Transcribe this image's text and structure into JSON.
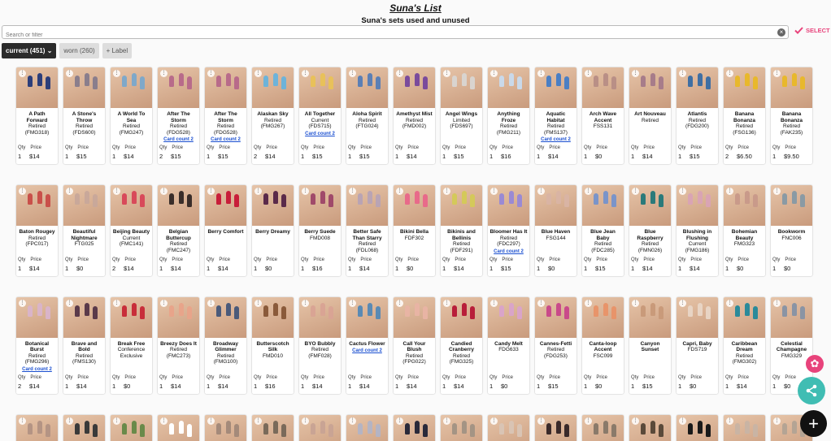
{
  "page": {
    "title": "Suna's List",
    "subtitle": "Suna's sets used and unused"
  },
  "search": {
    "placeholder": "Search or filter",
    "value": "",
    "clear_icon": "close-circle-icon"
  },
  "select": {
    "label": "SELECT",
    "icon": "check-icon",
    "color": "#e8437b"
  },
  "tabs": [
    {
      "label": "current (451)",
      "icon": "chevron-down-icon",
      "active": true
    },
    {
      "label": "worn (260)",
      "active": false
    },
    {
      "label": "+ Label",
      "active": false
    }
  ],
  "qty_label": "Qty",
  "price_label": "Price",
  "card_count_label": "Card count 2",
  "cards": [
    {
      "name": "A Path Forward",
      "status": "Retired",
      "code": "(FMG318)",
      "qty": "1",
      "price": "$14",
      "color": "#2c3e7a"
    },
    {
      "name": "A Stone's Throw",
      "status": "Retired",
      "code": "(FDS600)",
      "qty": "1",
      "price": "$15",
      "color": "#8a7e8c"
    },
    {
      "name": "A World To Sea",
      "status": "Retired",
      "code": "(FMG247)",
      "qty": "1",
      "price": "$14",
      "color": "#7fa8c9"
    },
    {
      "name": "After The Storm",
      "status": "Retired",
      "code": "(FDG528)",
      "qty": "2",
      "price": "$15",
      "color": "#b86b8a",
      "card_count": true
    },
    {
      "name": "After The Storm",
      "status": "Retired",
      "code": "(FDG528)",
      "qty": "1",
      "price": "$15",
      "color": "#b86b8a",
      "card_count": true
    },
    {
      "name": "Alaskan Sky",
      "status": "Retired",
      "code": "(FMG267)",
      "qty": "2",
      "price": "$14",
      "color": "#6db3d9"
    },
    {
      "name": "All Together",
      "status": "Current",
      "code": "(FDS715)",
      "qty": "1",
      "price": "$15",
      "color": "#e8c15a",
      "card_count": true
    },
    {
      "name": "Aloha Spirit",
      "status": "Retired",
      "code": "(FTG024)",
      "qty": "1",
      "price": "$15",
      "color": "#5b7fb5"
    },
    {
      "name": "Amethyst Mist",
      "status": "Retired",
      "code": "(FMD002)",
      "qty": "1",
      "price": "$14",
      "color": "#7a4b9c"
    },
    {
      "name": "Angel Wings",
      "status": "Limited",
      "code": "(FDS697)",
      "qty": "1",
      "price": "$15",
      "color": "#d9d4cf"
    },
    {
      "name": "Anything Froze",
      "status": "Retired",
      "code": "(FMG211)",
      "qty": "1",
      "price": "$16",
      "color": "#c9d9ea"
    },
    {
      "name": "Aquatic Habitat",
      "status": "Retired",
      "code": "(FMS137)",
      "qty": "1",
      "price": "$14",
      "color": "#4a7fc4",
      "card_count": true
    },
    {
      "name": "Arch Wave Accent",
      "status": "FSS131",
      "code": "",
      "qty": "1",
      "price": "$0",
      "color": "#b98f86"
    },
    {
      "name": "Art Nouveau",
      "status": "Retired",
      "code": "",
      "qty": "1",
      "price": "$14",
      "color": "#a77c8a"
    },
    {
      "name": "Atlantis",
      "status": "Retired",
      "code": "(FDG200)",
      "qty": "1",
      "price": "$15",
      "color": "#3f6fa3"
    },
    {
      "name": "Banana Bonanza",
      "status": "Retired",
      "code": "(FSG136)",
      "qty": "2",
      "price": "$6.50",
      "color": "#e8b82c"
    },
    {
      "name": "Banana Bonanza",
      "status": "Retired",
      "code": "(FAK235)",
      "qty": "1",
      "price": "$9.50",
      "color": "#e8b82c"
    },
    {
      "name": "Baton Rougey",
      "status": "Retired",
      "code": "(FPC017)",
      "qty": "1",
      "price": "$14",
      "color": "#c9504a"
    },
    {
      "name": "Beautiful Nightmare",
      "status": "FTG025",
      "code": "",
      "qty": "1",
      "price": "$0",
      "color": "#c9a89a"
    },
    {
      "name": "Beijing Beauty",
      "status": "Current",
      "code": "(FMC141)",
      "qty": "2",
      "price": "$14",
      "color": "#d84a5a"
    },
    {
      "name": "Belgian Buttercup",
      "status": "Retired",
      "code": "(FMC247)",
      "qty": "1",
      "price": "$14",
      "color": "#3a2e2a"
    },
    {
      "name": "Berry Comfort",
      "status": "",
      "code": "",
      "qty": "1",
      "price": "$14",
      "color": "#c81e3a"
    },
    {
      "name": "Berry Dreamy",
      "status": "",
      "code": "",
      "qty": "1",
      "price": "$0",
      "color": "#5a2a4a"
    },
    {
      "name": "Berry Suede",
      "status": "FMD008",
      "code": "",
      "qty": "1",
      "price": "$16",
      "color": "#a04a6a"
    },
    {
      "name": "Better Safe Than Starry",
      "status": "Retired",
      "code": "(FDL068)",
      "qty": "1",
      "price": "$14",
      "color": "#b9a4b4"
    },
    {
      "name": "Bikini Bella",
      "status": "FDF302",
      "code": "",
      "qty": "1",
      "price": "$0",
      "color": "#e86a8a"
    },
    {
      "name": "Bikinis and Bellinis",
      "status": "Retired",
      "code": "(FDF291)",
      "qty": "1",
      "price": "$14",
      "color": "#d4c95a"
    },
    {
      "name": "Bloomer Has It",
      "status": "Retired",
      "code": "(FDC297)",
      "qty": "1",
      "price": "$15",
      "color": "#9a8ad4",
      "card_count": true
    },
    {
      "name": "Blue Haven",
      "status": "FSG144",
      "code": "",
      "qty": "1",
      "price": "$0",
      "color": "#d9b4a4"
    },
    {
      "name": "Blue Jean Baby",
      "status": "Retired",
      "code": "(FDC285)",
      "qty": "1",
      "price": "$15",
      "color": "#7a94c9"
    },
    {
      "name": "Blue Raspberry",
      "status": "Retired",
      "code": "(FMN026)",
      "qty": "1",
      "price": "$14",
      "color": "#2a7a7a"
    },
    {
      "name": "Blushing in Flushing",
      "status": "Current",
      "code": "(FMG186)",
      "qty": "1",
      "price": "$14",
      "color": "#d9a4b4"
    },
    {
      "name": "Bohemian Beauty",
      "status": "FMG323",
      "code": "",
      "qty": "1",
      "price": "$0",
      "color": "#c99a8a"
    },
    {
      "name": "Bookworm",
      "status": "FNC006",
      "code": "",
      "qty": "1",
      "price": "$0",
      "color": "#8a9aa4"
    },
    {
      "name": "Botanical Burst",
      "status": "Retired",
      "code": "(FMG296)",
      "qty": "2",
      "price": "$14",
      "color": "#d9b4c9",
      "card_count": true
    },
    {
      "name": "Brave and Bold",
      "status": "Retired",
      "code": "(FMS130)",
      "qty": "1",
      "price": "$14",
      "color": "#5a3a4a"
    },
    {
      "name": "Break Free",
      "status": "Conference Exclusive",
      "code": "",
      "qty": "1",
      "price": "$0",
      "color": "#c82e3a"
    },
    {
      "name": "Breezy Does It",
      "status": "Retired",
      "code": "(FMC273)",
      "qty": "1",
      "price": "$14",
      "color": "#e8a48a"
    },
    {
      "name": "Broadway Glimmer",
      "status": "Retired",
      "code": "(FMG100)",
      "qty": "1",
      "price": "$14",
      "color": "#4a5a7a"
    },
    {
      "name": "Butterscotch Silk",
      "status": "FMD010",
      "code": "",
      "qty": "1",
      "price": "$16",
      "color": "#8a5a3a"
    },
    {
      "name": "BYO Bubbly",
      "status": "Retired",
      "code": "(FMF028)",
      "qty": "1",
      "price": "$14",
      "color": "#d9a494"
    },
    {
      "name": "Cactus Flower",
      "status": "",
      "code": "",
      "qty": "1",
      "price": "$14",
      "color": "#5a8ab4",
      "card_count": true
    },
    {
      "name": "Call Your Blush",
      "status": "Retired",
      "code": "(FPG022)",
      "qty": "1",
      "price": "$14",
      "color": "#e8b4a4"
    },
    {
      "name": "Candied Cranberry",
      "status": "Retired",
      "code": "(FMG325)",
      "qty": "1",
      "price": "$14",
      "color": "#b81e3a"
    },
    {
      "name": "Candy Melt",
      "status": "FDG633",
      "code": "",
      "qty": "1",
      "price": "$0",
      "color": "#d9a4c9"
    },
    {
      "name": "Cannes-Fetti",
      "status": "Retired",
      "code": "(FDG253)",
      "qty": "1",
      "price": "$15",
      "color": "#c94a8a"
    },
    {
      "name": "Canta-loop Accent",
      "status": "FSC099",
      "code": "",
      "qty": "1",
      "price": "$0",
      "color": "#e8946a"
    },
    {
      "name": "Canyon Sunset",
      "status": "",
      "code": "",
      "qty": "1",
      "price": "$15",
      "color": "#c99a7a"
    },
    {
      "name": "Capri, Baby",
      "status": "FDS719",
      "code": "",
      "qty": "1",
      "price": "$0",
      "color": "#e8d4c4"
    },
    {
      "name": "Caribbean Dream",
      "status": "Retired",
      "code": "(FMG302)",
      "qty": "1",
      "price": "$14",
      "color": "#2a8a9a"
    },
    {
      "name": "Celestial Champagne",
      "status": "FMG329",
      "code": "",
      "qty": "1",
      "price": "$0",
      "color": "#8a94a4"
    },
    {
      "name": "",
      "status": "",
      "code": "",
      "qty": "",
      "price": "",
      "color": "#b49484"
    },
    {
      "name": "",
      "status": "",
      "code": "",
      "qty": "",
      "price": "",
      "color": "#3a3a3a"
    },
    {
      "name": "",
      "status": "",
      "code": "",
      "qty": "",
      "price": "",
      "color": "#6a8a4a"
    },
    {
      "name": "",
      "status": "",
      "code": "",
      "qty": "",
      "price": "",
      "color": "#ffffff"
    },
    {
      "name": "",
      "status": "",
      "code": "",
      "qty": "",
      "price": "",
      "color": "#a48a7a"
    },
    {
      "name": "",
      "status": "",
      "code": "",
      "qty": "",
      "price": "",
      "color": "#7a6a5a"
    },
    {
      "name": "",
      "status": "",
      "code": "",
      "qty": "",
      "price": "",
      "color": "#c9a494"
    },
    {
      "name": "",
      "status": "",
      "code": "",
      "qty": "",
      "price": "",
      "color": "#b4b4c4"
    },
    {
      "name": "",
      "status": "",
      "code": "",
      "qty": "",
      "price": "",
      "color": "#2a2a3a"
    },
    {
      "name": "",
      "status": "",
      "code": "",
      "qty": "",
      "price": "",
      "color": "#a49484"
    },
    {
      "name": "",
      "status": "",
      "code": "",
      "qty": "",
      "price": "",
      "color": "#d9c4b4"
    },
    {
      "name": "",
      "status": "",
      "code": "",
      "qty": "",
      "price": "",
      "color": "#3a2a2a"
    },
    {
      "name": "",
      "status": "",
      "code": "",
      "qty": "",
      "price": "",
      "color": "#8a7a6a"
    },
    {
      "name": "",
      "status": "",
      "code": "",
      "qty": "",
      "price": "",
      "color": "#5a4a3a"
    },
    {
      "name": "",
      "status": "",
      "code": "",
      "qty": "",
      "price": "",
      "color": "#1a1a1a"
    },
    {
      "name": "",
      "status": "",
      "code": "",
      "qty": "",
      "price": "",
      "color": "#c9b4a4"
    },
    {
      "name": "",
      "status": "",
      "code": "",
      "qty": "",
      "price": "",
      "color": "#b4a494"
    }
  ],
  "fabs": {
    "settings_icon": "gear-icon",
    "share_icon": "share-icon",
    "add_icon": "plus-icon"
  }
}
